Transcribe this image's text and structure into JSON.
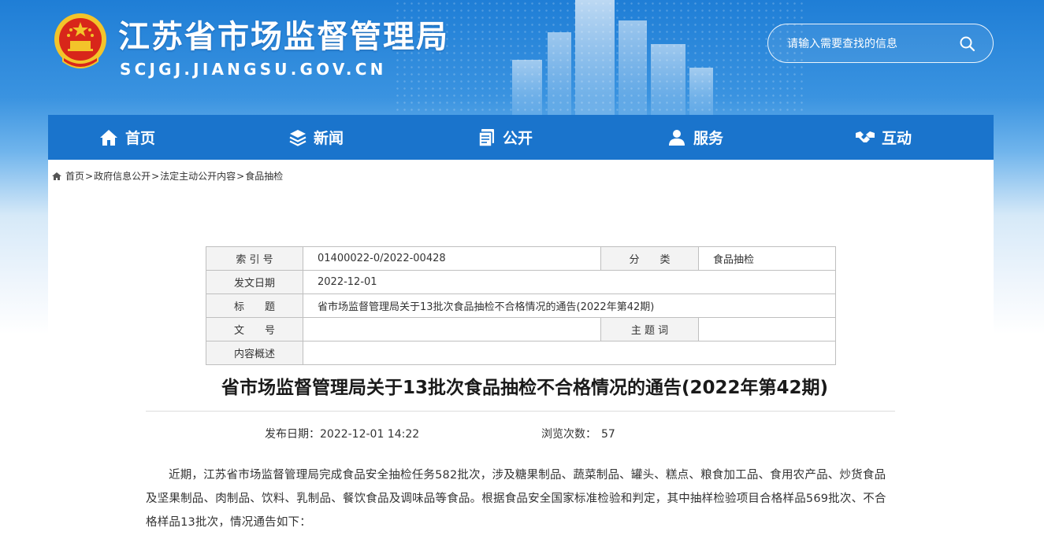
{
  "header": {
    "site_title": "江苏省市场监督管理局",
    "site_domain": "SCJGJ.JIANGSU.GOV.CN",
    "search_placeholder": "请输入需要查找的信息"
  },
  "nav": {
    "items": [
      {
        "label": "首页",
        "icon": "home-icon"
      },
      {
        "label": "新闻",
        "icon": "layers-icon"
      },
      {
        "label": "公开",
        "icon": "documents-icon"
      },
      {
        "label": "服务",
        "icon": "people-icon"
      },
      {
        "label": "互动",
        "icon": "handshake-icon"
      }
    ]
  },
  "breadcrumb": {
    "home": "首页",
    "items": [
      "政府信息公开",
      "法定主动公开内容",
      "食品抽检"
    ],
    "separator": ">"
  },
  "info_table": {
    "index_label": "索 引 号",
    "index_value": "01400022-0/2022-00428",
    "category_label": "分　　类",
    "category_value": "食品抽检",
    "date_label": "发文日期",
    "date_value": "2022-12-01",
    "title_label": "标　　题",
    "title_value": "省市场监督管理局关于13批次食品抽检不合格情况的通告(2022年第42期)",
    "docno_label": "文　　号",
    "docno_value": "",
    "subject_label": "主 题 词",
    "subject_value": "",
    "summary_label": "内容概述",
    "summary_value": ""
  },
  "article": {
    "title": "省市场监督管理局关于13批次食品抽检不合格情况的通告(2022年第42期)",
    "publish_label": "发布日期：",
    "publish_value": "2022-12-01 14:22",
    "views_label": "浏览次数：",
    "views_value": "57",
    "body": "近期，江苏省市场监督管理局完成食品安全抽检任务582批次，涉及糖果制品、蔬菜制品、罐头、糕点、粮食加工品、食用农产品、炒货食品及坚果制品、肉制品、饮料、乳制品、餐饮食品及调味品等食品。根据食品安全国家标准检验和判定，其中抽样检验项目合格样品569批次、不合格样品13批次，情况通告如下："
  },
  "colors": {
    "nav_bg": "#1a74cc",
    "header_blue": "#1f7ed6",
    "emblem_red": "#d8261a",
    "emblem_gold": "#f3c42a"
  }
}
